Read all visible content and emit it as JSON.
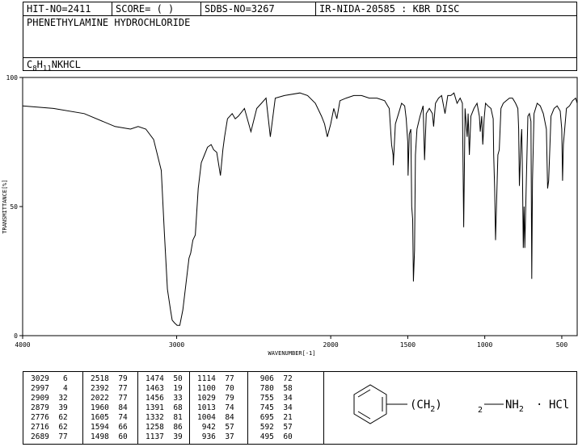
{
  "header": {
    "hit": "HIT-NO=2411",
    "score": "SCORE=  (   )",
    "sdbs": "SDBS-NO=3267",
    "method": "IR-NIDA-20585 : KBR DISC",
    "name": "PHENETHYLAMINE HYDROCHLORIDE",
    "formula_parts": [
      "C",
      "8",
      "H",
      "11",
      "NKHCL"
    ]
  },
  "chart_data": {
    "type": "line",
    "xlabel": "WAVENUMBER[-1]",
    "ylabel": "TRANSMITTANCE[%]",
    "xlim": [
      4000,
      400
    ],
    "ylim": [
      0,
      100
    ],
    "xticks": [
      4000,
      3000,
      2000,
      1500,
      1000,
      500
    ],
    "yticks": [
      0,
      50,
      100
    ],
    "grid": false,
    "series": [
      {
        "x": [
          4000,
          3800,
          3600,
          3400,
          3300,
          3250,
          3200,
          3150,
          3100,
          3080,
          3060,
          3040,
          3029,
          3015,
          2997,
          2980,
          2960,
          2940,
          2920,
          2909,
          2895,
          2879,
          2860,
          2840,
          2820,
          2800,
          2776,
          2760,
          2740,
          2716,
          2700,
          2689,
          2670,
          2640,
          2620,
          2600,
          2560,
          2518,
          2480,
          2450,
          2420,
          2392,
          2360,
          2300,
          2200,
          2150,
          2100,
          2060,
          2040,
          2022,
          2000,
          1980,
          1960,
          1940,
          1900,
          1850,
          1800,
          1750,
          1700,
          1650,
          1630,
          1620,
          1605,
          1595,
          1594,
          1580,
          1560,
          1540,
          1520,
          1510,
          1500,
          1498,
          1490,
          1480,
          1474,
          1468,
          1463,
          1456,
          1450,
          1440,
          1420,
          1400,
          1391,
          1380,
          1360,
          1340,
          1332,
          1320,
          1300,
          1280,
          1258,
          1240,
          1220,
          1200,
          1180,
          1160,
          1145,
          1137,
          1128,
          1114,
          1108,
          1100,
          1090,
          1070,
          1050,
          1035,
          1029,
          1020,
          1013,
          1008,
          1004,
          995,
          980,
          960,
          945,
          942,
          936,
          930,
          915,
          906,
          895,
          880,
          860,
          840,
          820,
          800,
          785,
          780,
          775,
          765,
          760,
          755,
          750,
          745,
          740,
          730,
          720,
          710,
          700,
          695,
          690,
          680,
          660,
          640,
          620,
          600,
          592,
          585,
          570,
          550,
          530,
          510,
          500,
          495,
          490,
          470,
          450,
          430,
          410,
          400
        ],
        "y": [
          89,
          88,
          86,
          81,
          80,
          81,
          80,
          76,
          64,
          40,
          18,
          10,
          6,
          5,
          4,
          4,
          10,
          20,
          30,
          32,
          37,
          39,
          57,
          67,
          70,
          73,
          74,
          72,
          71,
          62,
          72,
          77,
          84,
          86,
          84,
          85,
          88,
          79,
          88,
          90,
          92,
          77,
          92,
          93,
          94,
          93,
          90,
          85,
          82,
          77,
          82,
          88,
          84,
          91,
          92,
          93,
          93,
          92,
          92,
          91,
          89,
          88,
          74,
          70,
          66,
          82,
          86,
          90,
          89,
          84,
          75,
          62,
          78,
          80,
          50,
          45,
          21,
          33,
          70,
          80,
          85,
          89,
          68,
          86,
          88,
          86,
          81,
          90,
          92,
          93,
          86,
          93,
          93,
          94,
          90,
          92,
          90,
          42,
          88,
          77,
          86,
          70,
          85,
          88,
          90,
          85,
          79,
          85,
          74,
          79,
          84,
          90,
          89,
          88,
          84,
          70,
          57,
          37,
          70,
          72,
          88,
          90,
          91,
          92,
          92,
          90,
          88,
          80,
          58,
          75,
          80,
          60,
          34,
          50,
          34,
          60,
          85,
          86,
          83,
          22,
          60,
          86,
          90,
          89,
          86,
          80,
          57,
          60,
          85,
          88,
          89,
          87,
          80,
          60,
          74,
          88,
          89,
          91,
          92,
          90
        ]
      }
    ]
  },
  "peaks": [
    [
      [
        "3029",
        "6"
      ],
      [
        "2997",
        "4"
      ],
      [
        "2909",
        "32"
      ],
      [
        "2879",
        "39"
      ],
      [
        "2776",
        "62"
      ],
      [
        "2716",
        "62"
      ],
      [
        "2689",
        "77"
      ]
    ],
    [
      [
        "2518",
        "79"
      ],
      [
        "2392",
        "77"
      ],
      [
        "2022",
        "77"
      ],
      [
        "1960",
        "84"
      ],
      [
        "1605",
        "74"
      ],
      [
        "1594",
        "66"
      ],
      [
        "1498",
        "60"
      ]
    ],
    [
      [
        "1474",
        "50"
      ],
      [
        "1463",
        "19"
      ],
      [
        "1456",
        "33"
      ],
      [
        "1391",
        "68"
      ],
      [
        "1332",
        "81"
      ],
      [
        "1258",
        "86"
      ],
      [
        "1137",
        "39"
      ]
    ],
    [
      [
        "1114",
        "77"
      ],
      [
        "1100",
        "70"
      ],
      [
        "1029",
        "79"
      ],
      [
        "1013",
        "74"
      ],
      [
        "1004",
        "84"
      ],
      [
        "942",
        "57"
      ],
      [
        "936",
        "37"
      ]
    ],
    [
      [
        "906",
        "72"
      ],
      [
        "780",
        "58"
      ],
      [
        "755",
        "34"
      ],
      [
        "745",
        "34"
      ],
      [
        "695",
        "21"
      ],
      [
        "592",
        "57"
      ],
      [
        "495",
        "60"
      ]
    ]
  ],
  "structure": {
    "chain_label": "(CH",
    "chain_sub": "2",
    "chain_close": ")",
    "chain_count": "2",
    "dash": "—",
    "amine": "NH",
    "amine_sub": "2",
    "salt_dot": "·",
    "salt": "HCl"
  }
}
